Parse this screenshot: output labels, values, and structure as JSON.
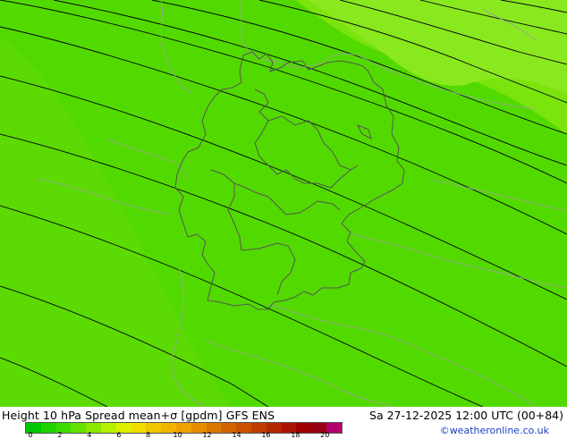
{
  "map": {
    "field_colors": {
      "main": "#52da00",
      "west_band": "#62da06",
      "northeast_band": "#7ae40c",
      "north_band": "#8ae81e"
    },
    "contour_color": "#000000",
    "border_color": "#555555",
    "coast_color": "#a0a0a0"
  },
  "footer": {
    "title": "Height 10 hPa Spread mean+σ [gpdm] GFS ENS",
    "datetime": "Sa 27-12-2025 12:00 UTC (00+84)",
    "credit": "©weatheronline.co.uk"
  },
  "colorbar": {
    "colors": [
      "#00c800",
      "#1ed200",
      "#3cdc00",
      "#64e100",
      "#8ce600",
      "#b4f000",
      "#dcf000",
      "#f0dc00",
      "#f0c800",
      "#f0b400",
      "#f0a000",
      "#e68c00",
      "#dc7800",
      "#d26400",
      "#c85000",
      "#be3c00",
      "#b42800",
      "#aa1400",
      "#a00000",
      "#960014",
      "#b4006e"
    ],
    "tick_labels": [
      "0",
      "2",
      "4",
      "6",
      "8",
      "10",
      "12",
      "14",
      "16",
      "18",
      "20"
    ]
  }
}
